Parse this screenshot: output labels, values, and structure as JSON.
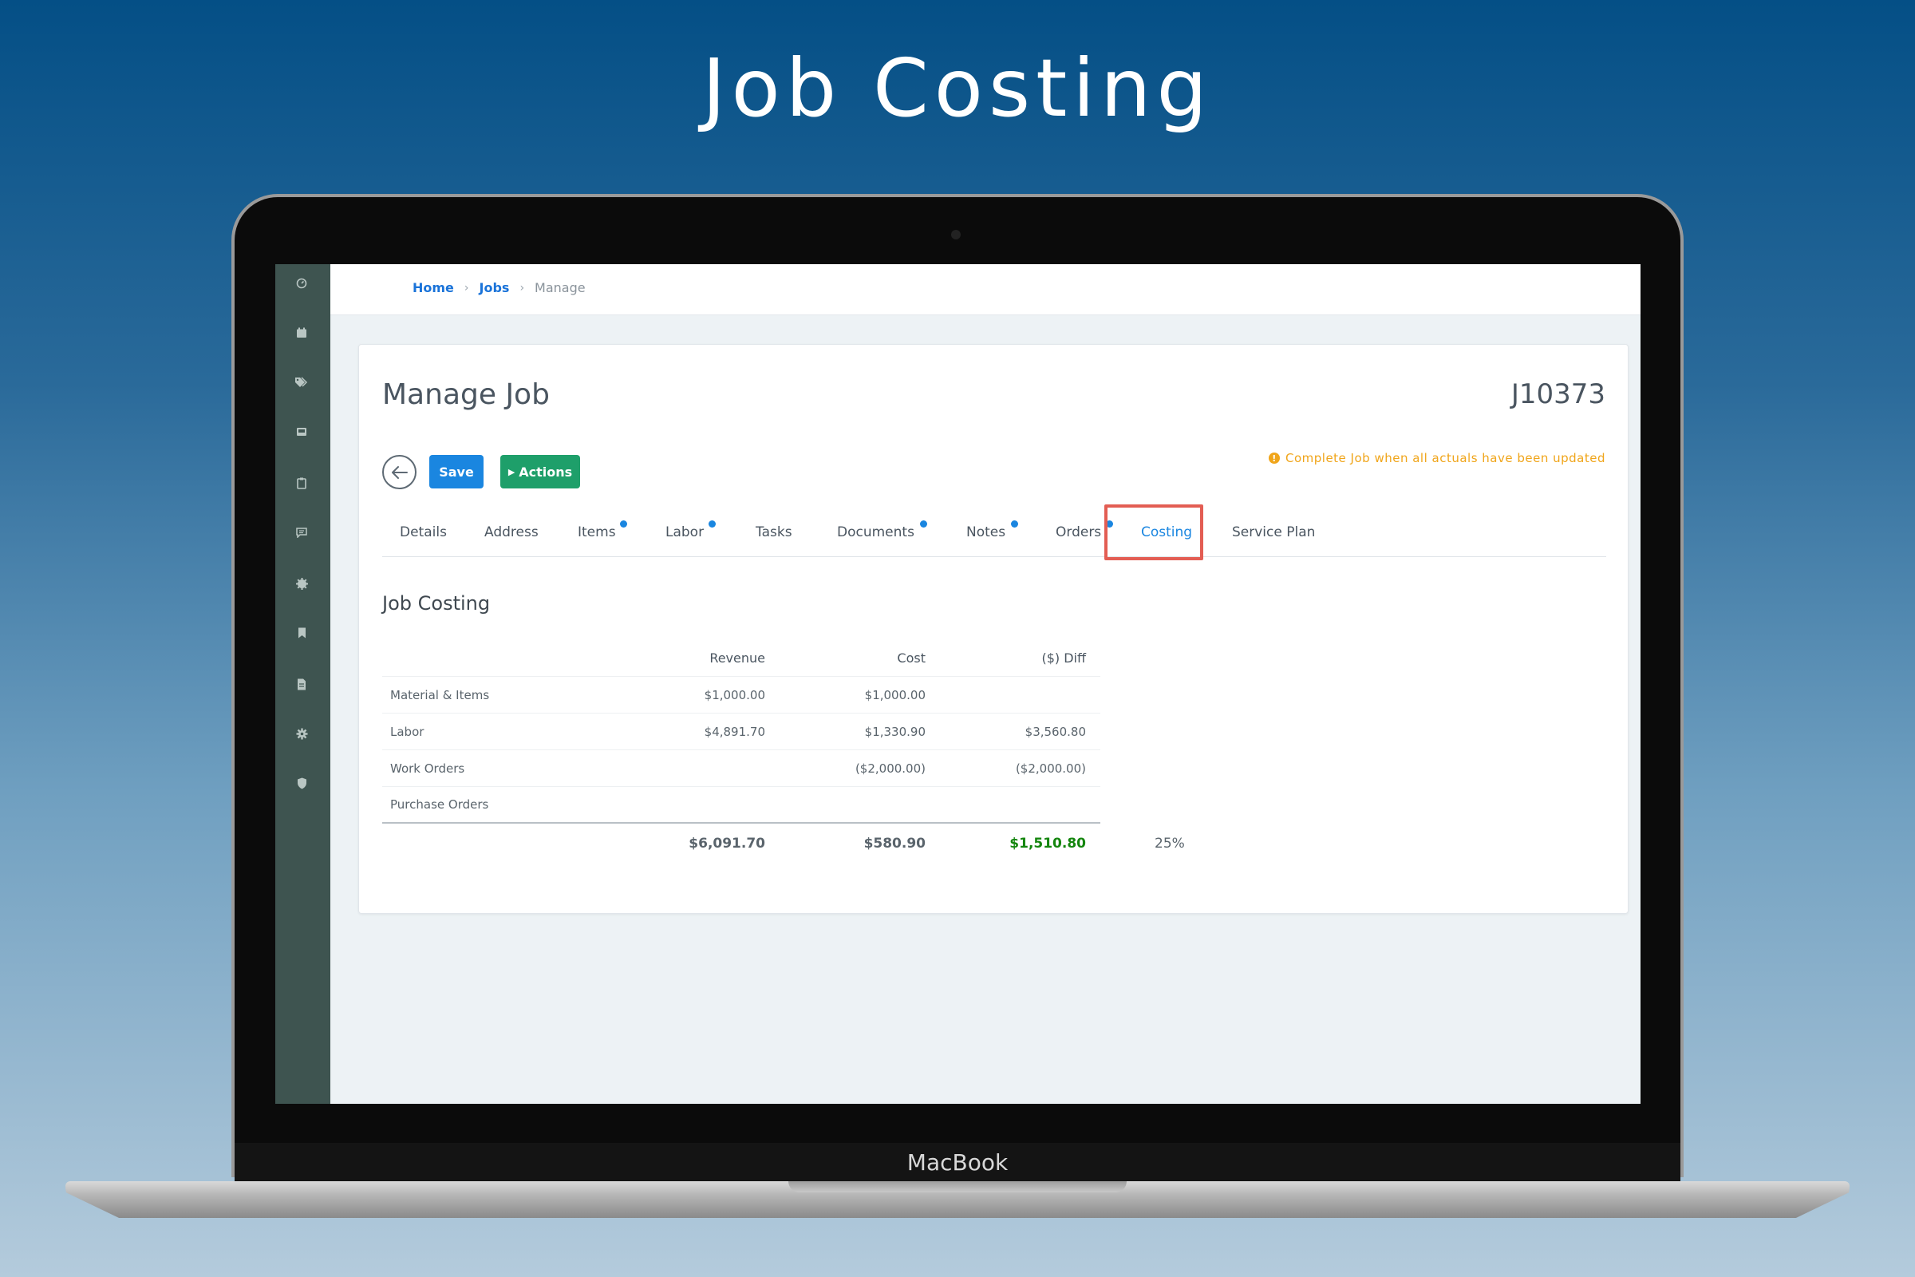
{
  "headline": "Job Costing",
  "device_label": "MacBook",
  "sidebar": {
    "icons": [
      "dashboard-icon",
      "calendar-icon",
      "tags-icon",
      "inbox-icon",
      "clipboard-icon",
      "chat-icon",
      "gear-badge-icon",
      "bookmark-icon",
      "document-icon",
      "settings-icon",
      "shield-icon"
    ]
  },
  "breadcrumb": {
    "home": "Home",
    "jobs": "Jobs",
    "current": "Manage"
  },
  "page": {
    "title": "Manage Job",
    "job_number": "J10373"
  },
  "toolbar": {
    "save_label": "Save",
    "actions_label": "Actions",
    "notice": "Complete Job when all actuals have been updated"
  },
  "tabs": [
    {
      "label": "Details",
      "dot": false
    },
    {
      "label": "Address",
      "dot": false
    },
    {
      "label": "Items",
      "dot": true
    },
    {
      "label": "Labor",
      "dot": true
    },
    {
      "label": "Tasks",
      "dot": false
    },
    {
      "label": "Documents",
      "dot": true
    },
    {
      "label": "Notes",
      "dot": true
    },
    {
      "label": "Orders",
      "dot": true
    },
    {
      "label": "Costing",
      "dot": false,
      "active": true
    },
    {
      "label": "Service Plan",
      "dot": false
    }
  ],
  "costing": {
    "title": "Job Costing",
    "headers": {
      "revenue": "Revenue",
      "cost": "Cost",
      "diff": "($) Diff"
    },
    "rows": [
      {
        "label": "Material & Items",
        "revenue": "$1,000.00",
        "cost": "$1,000.00",
        "diff": ""
      },
      {
        "label": "Labor",
        "revenue": "$4,891.70",
        "cost": "$1,330.90",
        "diff": "$3,560.80"
      },
      {
        "label": "Work Orders",
        "revenue": "",
        "cost": "($2,000.00)",
        "diff": "($2,000.00)"
      },
      {
        "label": "Purchase Orders",
        "revenue": "",
        "cost": "",
        "diff": ""
      }
    ],
    "totals": {
      "revenue": "$6,091.70",
      "cost": "$580.90",
      "diff": "$1,510.80",
      "percent": "25%"
    }
  },
  "colors": {
    "primary": "#1a86e0",
    "success": "#1e9f6a",
    "warning": "#f0a51a",
    "highlight": "#e35d53",
    "positive_total": "#14860e",
    "sidebar": "#3e5450"
  }
}
